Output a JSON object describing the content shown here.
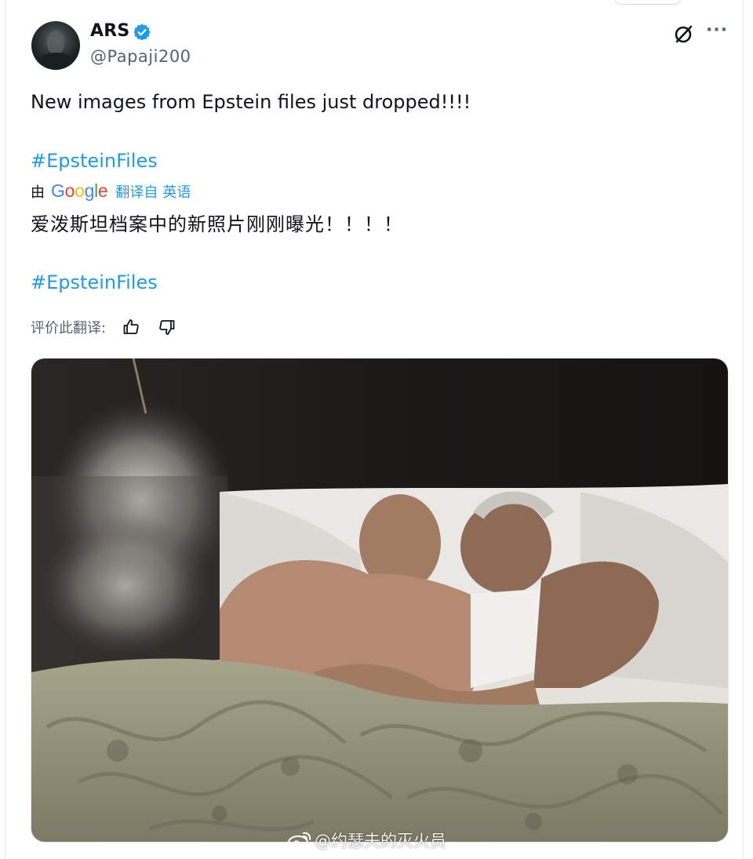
{
  "author": {
    "name": "ARS",
    "handle": "@Papaji200",
    "verified": true
  },
  "tweet": {
    "text": "New images from Epstein files just dropped!!!!",
    "hashtag": "#EpsteinFiles"
  },
  "translation": {
    "by_prefix": "由",
    "provider": "Google",
    "from_label": "翻译自",
    "source_language": "英语",
    "text": "爱泼斯坦档案中的新照片刚刚曝光！！！！",
    "hashtag": "#EpsteinFiles",
    "rate_label": "评价此翻译:"
  },
  "media": {
    "type": "photo"
  },
  "watermark": {
    "text": "@约瑟夫的灭火员"
  },
  "icons": {
    "verified": "verified-badge-icon",
    "grok": "grok-icon",
    "more": "more-icon",
    "thumbs_up": "thumbs-up-icon",
    "thumbs_down": "thumbs-down-icon",
    "weibo": "weibo-icon"
  },
  "colors": {
    "accent": "#1d9bf0",
    "text": "#0f1419",
    "muted": "#536471"
  }
}
